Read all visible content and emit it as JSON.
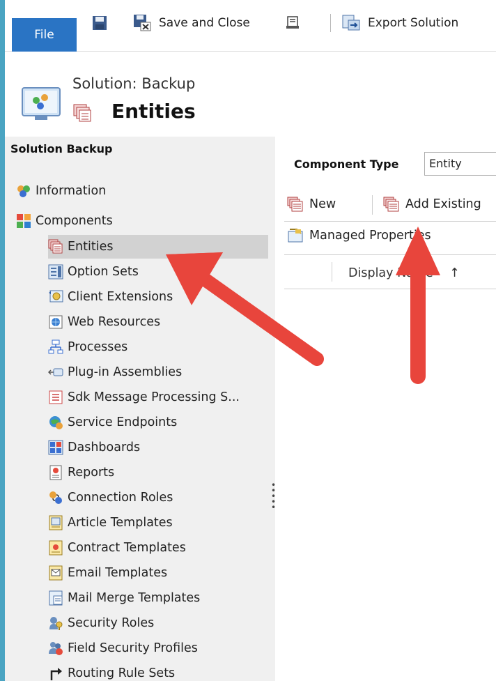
{
  "ribbon": {
    "file_label": "File",
    "save_and_close_label": "Save and Close",
    "export_solution_label": "Export Solution"
  },
  "header": {
    "solution_label": "Solution: Backup",
    "title": "Entities"
  },
  "sidebar": {
    "title": "Solution Backup",
    "information_label": "Information",
    "components_label": "Components",
    "items": [
      {
        "label": "Entities",
        "icon": "entity-icon"
      },
      {
        "label": "Option Sets",
        "icon": "option-sets-icon"
      },
      {
        "label": "Client Extensions",
        "icon": "client-extensions-icon"
      },
      {
        "label": "Web Resources",
        "icon": "web-resources-icon"
      },
      {
        "label": "Processes",
        "icon": "processes-icon"
      },
      {
        "label": "Plug-in Assemblies",
        "icon": "plugin-assemblies-icon"
      },
      {
        "label": "Sdk Message Processing S...",
        "icon": "sdk-message-icon"
      },
      {
        "label": "Service Endpoints",
        "icon": "service-endpoints-icon"
      },
      {
        "label": "Dashboards",
        "icon": "dashboards-icon"
      },
      {
        "label": "Reports",
        "icon": "reports-icon"
      },
      {
        "label": "Connection Roles",
        "icon": "connection-roles-icon"
      },
      {
        "label": "Article Templates",
        "icon": "article-templates-icon"
      },
      {
        "label": "Contract Templates",
        "icon": "contract-templates-icon"
      },
      {
        "label": "Email Templates",
        "icon": "email-templates-icon"
      },
      {
        "label": "Mail Merge Templates",
        "icon": "mail-merge-icon"
      },
      {
        "label": "Security Roles",
        "icon": "security-roles-icon"
      },
      {
        "label": "Field Security Profiles",
        "icon": "field-security-icon"
      },
      {
        "label": "Routing Rule Sets",
        "icon": "routing-rule-icon"
      }
    ]
  },
  "main": {
    "component_type_label": "Component Type",
    "component_type_value": "Entity",
    "new_label": "New",
    "add_existing_label": "Add Existing",
    "managed_properties_label": "Managed Properties",
    "display_name_header": "Display Name",
    "sort_indicator": "↑"
  },
  "colors": {
    "file_button": "#2a74c4",
    "sidebar_bg": "#f0f0f0",
    "selected_item": "#d2d2d2",
    "arrow": "#e8453c"
  }
}
